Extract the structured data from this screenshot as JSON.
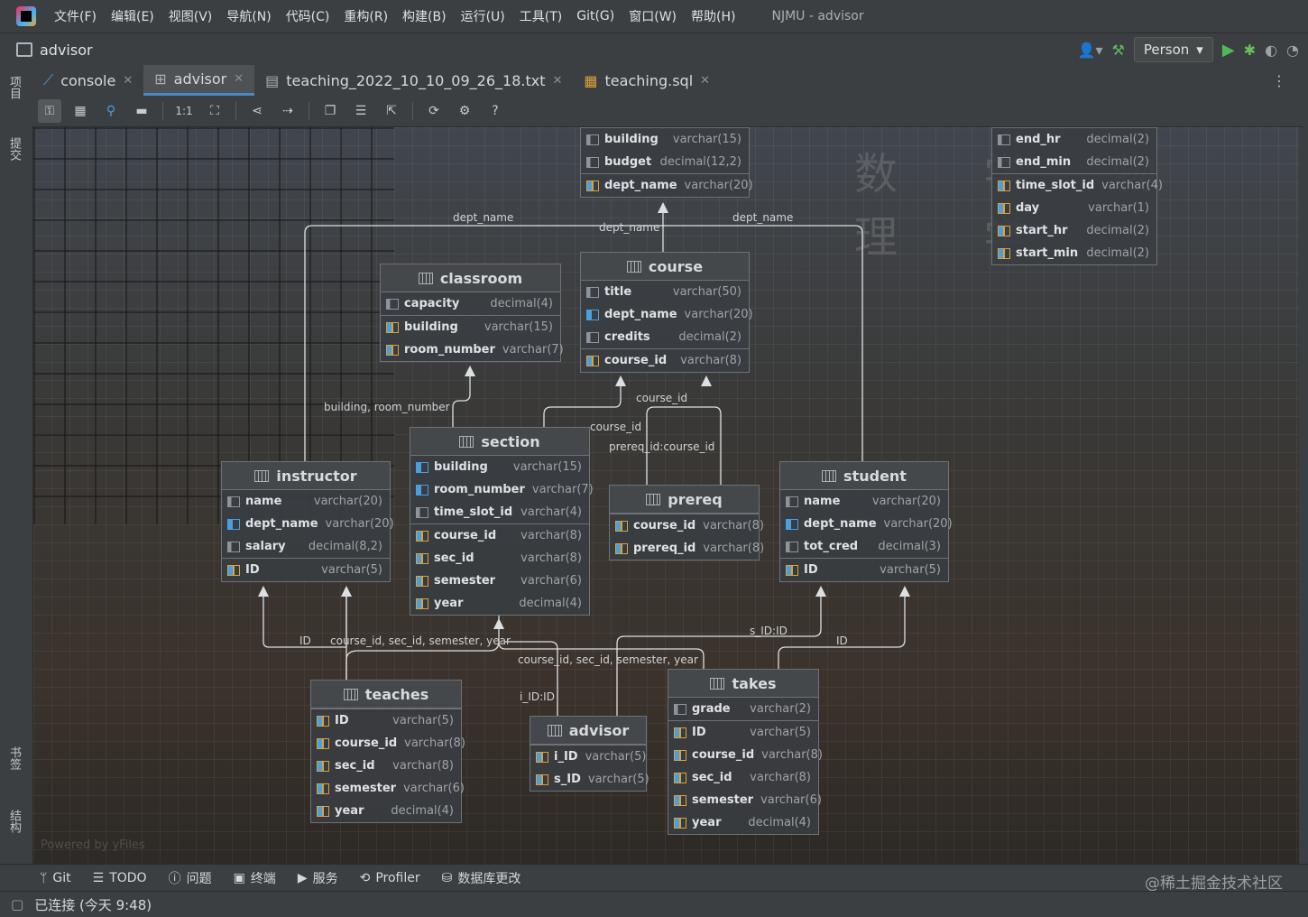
{
  "menubar": {
    "items": [
      "文件(F)",
      "编辑(E)",
      "视图(V)",
      "导航(N)",
      "代码(C)",
      "重构(R)",
      "构建(B)",
      "运行(U)",
      "工具(T)",
      "Git(G)",
      "窗口(W)",
      "帮助(H)"
    ],
    "window_title": "NJMU - advisor"
  },
  "navbar": {
    "project": "advisor",
    "run_config": "Person"
  },
  "leftbar": {
    "top": [
      "项目",
      "提交"
    ],
    "bottom": [
      "书签",
      "结构"
    ]
  },
  "tabs": [
    {
      "label": "console",
      "icon": "console-icon"
    },
    {
      "label": "advisor",
      "icon": "diagram-icon"
    },
    {
      "label": "teaching_2022_10_10_09_26_18.txt",
      "icon": "text-file-icon"
    },
    {
      "label": "teaching.sql",
      "icon": "sql-file-icon"
    }
  ],
  "toolbar": {
    "zoom_actual": "1:1",
    "help": "?"
  },
  "diagram": {
    "tables": {
      "department": {
        "name": "",
        "cols": [
          {
            "name": "building",
            "type": "varchar(15)",
            "kind": "col"
          },
          {
            "name": "budget",
            "type": "decimal(12,2)",
            "kind": "col"
          },
          {
            "name": "dept_name",
            "type": "varchar(20)",
            "kind": "pk"
          }
        ]
      },
      "time_slot": {
        "name": "",
        "cols": [
          {
            "name": "end_hr",
            "type": "decimal(2)",
            "kind": "col"
          },
          {
            "name": "end_min",
            "type": "decimal(2)",
            "kind": "col"
          },
          {
            "name": "time_slot_id",
            "type": "varchar(4)",
            "kind": "pk"
          },
          {
            "name": "day",
            "type": "varchar(1)",
            "kind": "pk"
          },
          {
            "name": "start_hr",
            "type": "decimal(2)",
            "kind": "pk"
          },
          {
            "name": "start_min",
            "type": "decimal(2)",
            "kind": "pk"
          }
        ]
      },
      "classroom": {
        "name": "classroom",
        "cols": [
          {
            "name": "capacity",
            "type": "decimal(4)",
            "kind": "col"
          },
          {
            "name": "building",
            "type": "varchar(15)",
            "kind": "pk"
          },
          {
            "name": "room_number",
            "type": "varchar(7)",
            "kind": "pk"
          }
        ]
      },
      "course": {
        "name": "course",
        "cols": [
          {
            "name": "title",
            "type": "varchar(50)",
            "kind": "col"
          },
          {
            "name": "dept_name",
            "type": "varchar(20)",
            "kind": "fk"
          },
          {
            "name": "credits",
            "type": "decimal(2)",
            "kind": "col"
          },
          {
            "name": "course_id",
            "type": "varchar(8)",
            "kind": "pk"
          }
        ]
      },
      "section": {
        "name": "section",
        "cols": [
          {
            "name": "building",
            "type": "varchar(15)",
            "kind": "fk"
          },
          {
            "name": "room_number",
            "type": "varchar(7)",
            "kind": "fk"
          },
          {
            "name": "time_slot_id",
            "type": "varchar(4)",
            "kind": "col"
          },
          {
            "name": "course_id",
            "type": "varchar(8)",
            "kind": "pk"
          },
          {
            "name": "sec_id",
            "type": "varchar(8)",
            "kind": "pk"
          },
          {
            "name": "semester",
            "type": "varchar(6)",
            "kind": "pk"
          },
          {
            "name": "year",
            "type": "decimal(4)",
            "kind": "pk"
          }
        ]
      },
      "instructor": {
        "name": "instructor",
        "cols": [
          {
            "name": "name",
            "type": "varchar(20)",
            "kind": "col"
          },
          {
            "name": "dept_name",
            "type": "varchar(20)",
            "kind": "fk"
          },
          {
            "name": "salary",
            "type": "decimal(8,2)",
            "kind": "col"
          },
          {
            "name": "ID",
            "type": "varchar(5)",
            "kind": "pk"
          }
        ]
      },
      "prereq": {
        "name": "prereq",
        "cols": [
          {
            "name": "course_id",
            "type": "varchar(8)",
            "kind": "pk"
          },
          {
            "name": "prereq_id",
            "type": "varchar(8)",
            "kind": "pk"
          }
        ]
      },
      "student": {
        "name": "student",
        "cols": [
          {
            "name": "name",
            "type": "varchar(20)",
            "kind": "col"
          },
          {
            "name": "dept_name",
            "type": "varchar(20)",
            "kind": "fk"
          },
          {
            "name": "tot_cred",
            "type": "decimal(3)",
            "kind": "col"
          },
          {
            "name": "ID",
            "type": "varchar(5)",
            "kind": "pk"
          }
        ]
      },
      "teaches": {
        "name": "teaches",
        "cols": [
          {
            "name": "ID",
            "type": "varchar(5)",
            "kind": "pk"
          },
          {
            "name": "course_id",
            "type": "varchar(8)",
            "kind": "pk"
          },
          {
            "name": "sec_id",
            "type": "varchar(8)",
            "kind": "pk"
          },
          {
            "name": "semester",
            "type": "varchar(6)",
            "kind": "pk"
          },
          {
            "name": "year",
            "type": "decimal(4)",
            "kind": "pk"
          }
        ]
      },
      "advisor": {
        "name": "advisor",
        "cols": [
          {
            "name": "i_ID",
            "type": "varchar(5)",
            "kind": "pk"
          },
          {
            "name": "s_ID",
            "type": "varchar(5)",
            "kind": "pk"
          }
        ]
      },
      "takes": {
        "name": "takes",
        "cols": [
          {
            "name": "grade",
            "type": "varchar(2)",
            "kind": "col"
          },
          {
            "name": "ID",
            "type": "varchar(5)",
            "kind": "pk"
          },
          {
            "name": "course_id",
            "type": "varchar(8)",
            "kind": "pk"
          },
          {
            "name": "sec_id",
            "type": "varchar(8)",
            "kind": "pk"
          },
          {
            "name": "semester",
            "type": "varchar(6)",
            "kind": "pk"
          },
          {
            "name": "year",
            "type": "decimal(4)",
            "kind": "pk"
          }
        ]
      }
    },
    "edge_labels": {
      "dept_name_1": "dept_name",
      "dept_name_2": "dept_name",
      "dept_name_3": "dept_name",
      "building_room": "building, room_number",
      "course_id_1": "course_id",
      "course_id_2": "course_id",
      "prereq_map": "prereq_id:course_id",
      "id_1": "ID",
      "section_keys_1": "course_id, sec_id, semester, year",
      "sid_map": "s_ID:ID",
      "id_2": "ID",
      "section_keys_2": "course_id, sec_id, semester, year",
      "iid_map": "i_ID:ID"
    },
    "decor_text": "数 学 物 理 学",
    "powered_by": "Powered by yFiles"
  },
  "bottombar": [
    "Git",
    "TODO",
    "问题",
    "终端",
    "服务",
    "Profiler",
    "数据库更改"
  ],
  "status": {
    "text": "已连接 (今天 9:48)"
  },
  "watermark": "@稀土掘金技术社区"
}
